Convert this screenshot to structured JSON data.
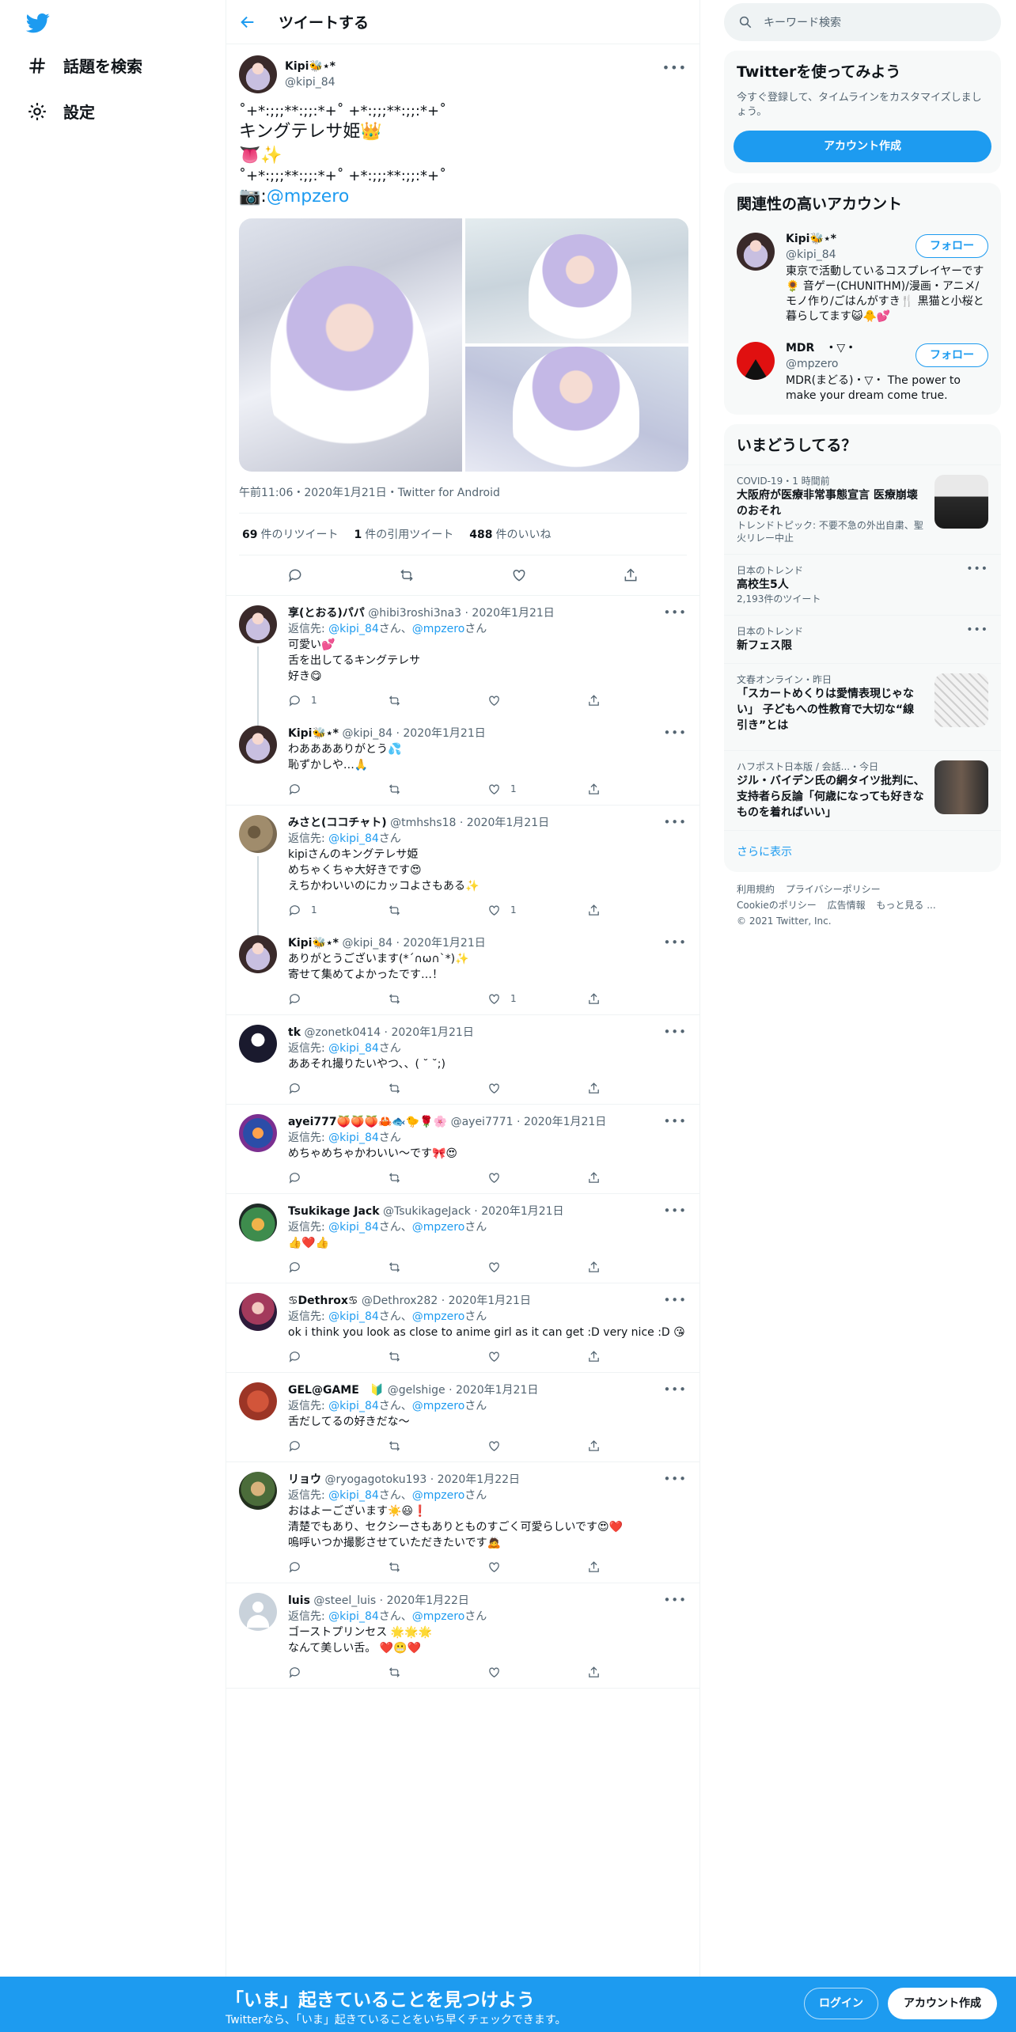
{
  "nav": {
    "explore": "話題を検索",
    "settings": "設定"
  },
  "header": {
    "title": "ツイートする"
  },
  "main_tweet": {
    "name": "Kipi🐝⋆*",
    "handle": "@kipi_84",
    "line1": "˚+*:;;;**:;;:*+˚ +*:;;;**:;;:*+˚",
    "line2": "キングテレサ姫👑",
    "line3": "👅✨",
    "line4": "˚+*:;;;**:;;:*+˚ +*:;;;**:;;:*+˚",
    "photo_prefix": "📷:",
    "photo_credit": "@mpzero",
    "meta": "午前11:06・2020年1月21日・Twitter for Android",
    "retweets": "69",
    "retweets_label": "件のリツイート",
    "quotes": "1",
    "quotes_label": "件の引用ツイート",
    "likes": "488",
    "likes_label": "件のいいね"
  },
  "replies": [
    {
      "name": "享(とおる)パパ",
      "handle": "@hibi3roshi3na3",
      "date": "2020年1月21日",
      "reply_to": "返信先:",
      "mention1": "@kipi_84",
      "mention2": "@mpzero",
      "suffix": "さん",
      "text": [
        "可愛い💕",
        "舌を出してるキングテレサ",
        "好き😋"
      ],
      "reply_count": "1",
      "rt_count": "",
      "like_count": ""
    },
    {
      "name": "Kipi🐝⋆*",
      "handle": "@kipi_84",
      "date": "2020年1月21日",
      "text": [
        "わあああありがとう💦",
        "恥ずかしや…🙏"
      ],
      "reply_count": "",
      "rt_count": "",
      "like_count": "1"
    },
    {
      "name": "みさと(ココチャト)",
      "handle": "@tmhshs18",
      "date": "2020年1月21日",
      "reply_to": "返信先:",
      "mention1": "@kipi_84",
      "suffix": "さん",
      "text": [
        "kipiさんのキングテレサ姫",
        "めちゃくちゃ大好きです😍",
        "えちかわいいのにカッコよさもある✨"
      ],
      "reply_count": "1",
      "rt_count": "",
      "like_count": "1"
    },
    {
      "name": "Kipi🐝⋆*",
      "handle": "@kipi_84",
      "date": "2020年1月21日",
      "text": [
        "ありがとうございます(*´∩ω∩`*)✨",
        "寄せて集めてよかったです…！"
      ],
      "reply_count": "",
      "rt_count": "",
      "like_count": "1"
    },
    {
      "name": "tk",
      "handle": "@zonetk0414",
      "date": "2020年1月21日",
      "reply_to": "返信先:",
      "mention1": "@kipi_84",
      "suffix": "さん",
      "text": [
        "ああそれ撮りたいやつ、、( ˘ ˘;)"
      ],
      "reply_count": "",
      "rt_count": "",
      "like_count": ""
    },
    {
      "name": "ayei777🍑🍑🍑🦀🐟🐤🌹🌸",
      "handle": "@ayei7771",
      "date": "2020年1月21日",
      "reply_to": "返信先:",
      "mention1": "@kipi_84",
      "suffix": "さん",
      "text": [
        "めちゃめちゃかわいい～です🎀😍"
      ],
      "reply_count": "",
      "rt_count": "",
      "like_count": ""
    },
    {
      "name": "Tsukikage Jack",
      "handle": "@TsukikageJack",
      "date": "2020年1月21日",
      "reply_to": "返信先:",
      "mention1": "@kipi_84",
      "mention2": "@mpzero",
      "suffix": "さん",
      "text": [
        "👍❤️👍"
      ],
      "reply_count": "",
      "rt_count": "",
      "like_count": ""
    },
    {
      "name": "♋Dethrox♋",
      "handle": "@Dethrox282",
      "date": "2020年1月21日",
      "reply_to": "返信先:",
      "mention1": "@kipi_84",
      "mention2": "@mpzero",
      "suffix": "さん",
      "text": [
        "ok i think you look as close to anime girl as it can get :D very nice :D 😘"
      ],
      "reply_count": "",
      "rt_count": "",
      "like_count": ""
    },
    {
      "name": "GEL@GAME　🔰",
      "handle": "@gelshige",
      "date": "2020年1月21日",
      "reply_to": "返信先:",
      "mention1": "@kipi_84",
      "mention2": "@mpzero",
      "suffix": "さん",
      "text": [
        "舌だしてるの好きだな～"
      ],
      "reply_count": "",
      "rt_count": "",
      "like_count": ""
    },
    {
      "name": "リョウ",
      "handle": "@ryogagotoku193",
      "date": "2020年1月22日",
      "reply_to": "返信先:",
      "mention1": "@kipi_84",
      "mention2": "@mpzero",
      "suffix": "さん",
      "text": [
        "おはよーございます☀️😃❗",
        "清楚でもあり、セクシーさもありとものすごく可愛らしいです😍❤️",
        "嗚呼いつか撮影させていただきたいです🙇"
      ],
      "reply_count": "",
      "rt_count": "",
      "like_count": ""
    },
    {
      "name": "luis",
      "handle": "@steel_luis",
      "date": "2020年1月22日",
      "reply_to": "返信先:",
      "mention1": "@kipi_84",
      "mention2": "@mpzero",
      "suffix": "さん",
      "text": [
        "ゴーストプリンセス 🌟🌟🌟",
        "なんて美しい舌。 ❤️😬❤️"
      ],
      "reply_count": "",
      "rt_count": "",
      "like_count": ""
    }
  ],
  "right": {
    "search_placeholder": "キーワード検索",
    "signup_title": "Twitterを使ってみよう",
    "signup_desc": "今すぐ登録して、タイムラインをカスタマイズしましょう。",
    "signup_button": "アカウント作成",
    "related_title": "関連性の高いアカウント",
    "accounts": [
      {
        "name": "Kipi🐝⋆*",
        "handle": "@kipi_84",
        "bio": "東京で活動しているコスプレイヤーです🌻 音ゲー(CHUNITHM)/漫画・アニメ/モノ作り/ごはんがすき🍴 黒猫と小桜と暮らしてます😺🐥💕",
        "follow": "フォロー"
      },
      {
        "name": "MDR　・▽・",
        "handle": "@mpzero",
        "bio": "MDR(まどる)・▽・ The power to make your dream come true.",
        "follow": "フォロー"
      }
    ],
    "trends_title": "いまどうしてる？",
    "trends": [
      {
        "ctx": "COVID-19・1 時間前",
        "title": "大阪府が医療非常事態宣言 医療崩壊のおそれ",
        "sub": "トレンドトピック: 不要不急の外出自粛、聖火リレー中止"
      },
      {
        "ctx": "日本のトレンド",
        "title": "高校生5人",
        "sub": "2,193件のツイート"
      },
      {
        "ctx": "日本のトレンド",
        "title": "新フェス限",
        "sub": ""
      },
      {
        "ctx": "文春オンライン・昨日",
        "title": "「スカートめくりは愛情表現じゃない」 子どもへの性教育で大切な“線引き”とは",
        "sub": ""
      },
      {
        "ctx": "ハフポスト日本版 / 会話...・今日",
        "title": "ジル・バイデン氏の網タイツ批判に、支持者ら反論「何歳になっても好きなものを着ればいい」",
        "sub": ""
      }
    ],
    "show_more": "さらに表示",
    "footer_line1": [
      "利用規約",
      "プライバシーポリシー"
    ],
    "footer_line2": [
      "Cookieのポリシー",
      "広告情報",
      "もっと見る ..."
    ],
    "copyright": "© 2021 Twitter, Inc."
  },
  "bottom": {
    "title": "「いま」起きていることを見つけよう",
    "subtitle": "Twitterなら、「いま」起きていることをいち早くチェックできます。",
    "login": "ログイン",
    "signup": "アカウント作成"
  },
  "colors": {
    "accent": "#1d9bf0",
    "text": "#0f1419",
    "muted": "#536471"
  }
}
